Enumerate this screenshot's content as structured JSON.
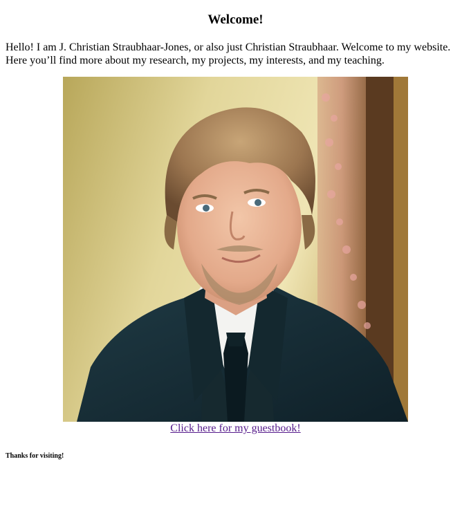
{
  "page": {
    "title": "Welcome!",
    "intro_line1": "Hello! I am J. Christian Straubhaar-Jones, or also just Christian Straubhaar. Welcome to my website.",
    "intro_line2": "Here you’ll find more about my research, my projects, my interests, and my teaching.",
    "guestbook_link": "Click here for my guestbook!",
    "footer": "Thanks for visiting!"
  },
  "colors": {
    "link_visited": "#551a8b",
    "background": "#ffffff",
    "text": "#000000"
  }
}
